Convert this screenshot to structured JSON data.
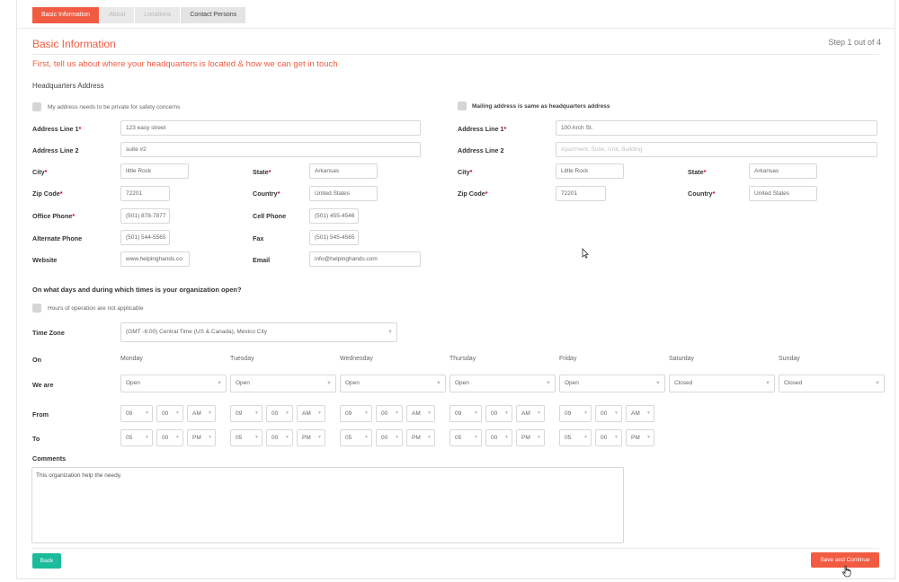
{
  "tabs": [
    {
      "label": "Basic Information"
    },
    {
      "label": "About"
    },
    {
      "label": "Locations"
    },
    {
      "label": "Contact Persons"
    }
  ],
  "section_title": "Basic Information",
  "step_text": "Step 1 out of 4",
  "intro_text": "First, tell us about where your headquarters is located & how we can get in touch",
  "hq_heading": "Headquarters Address",
  "private_label": "My address needs to be private for safety concerns",
  "mailing_same_label": "Mailing address is same as headquarters address",
  "req_mark": "*",
  "hq": {
    "address1_label": "Address Line 1",
    "address1_value": "123 easy street",
    "address2_label": "Address Line 2",
    "address2_value": "suite #2",
    "city_label": "City",
    "city_value": "little Rock",
    "state_label": "State",
    "state_value": "Arkansas",
    "zip_label": "Zip Code",
    "zip_value": "72201",
    "country_label": "Country",
    "country_value": "United States",
    "office_phone_label": "Office Phone",
    "office_phone_value": "(501) 878-7877",
    "cell_phone_label": "Cell Phone",
    "cell_phone_value": "(501) 455-4546",
    "alt_phone_label": "Alternate Phone",
    "alt_phone_value": "(501) 544-5565",
    "fax_label": "Fax",
    "fax_value": "(501) 545-4565",
    "website_label": "Website",
    "website_value": "www.helpinghands.co",
    "email_label": "Email",
    "email_value": "info@helpinghands.com"
  },
  "mailing": {
    "address1_label": "Address Line 1",
    "address1_value": "100 Arch St.",
    "address2_label": "Address Line 2",
    "address2_placeholder": "Apartment, Suite, Unit, Building",
    "city_label": "City",
    "city_value": "Little Rock",
    "state_label": "State",
    "state_value": "Arkansas",
    "zip_label": "Zip Code",
    "zip_value": "72201",
    "country_label": "Country",
    "country_value": "United States"
  },
  "hours_question": "On what days and during which times is your organization open?",
  "hours_na_label": "Hours of operation are not applicable",
  "timezone_label": "Time Zone",
  "timezone_value": "(GMT -6:00) Central Time (US & Canada), Mexico City",
  "on_label": "On",
  "we_are_label": "We are",
  "from_label": "From",
  "to_label": "To",
  "days": [
    {
      "name": "Monday",
      "status": "Open",
      "from_h": "09",
      "from_m": "00",
      "from_ap": "AM",
      "to_h": "05",
      "to_m": "00",
      "to_ap": "PM"
    },
    {
      "name": "Tuesday",
      "status": "Open",
      "from_h": "09",
      "from_m": "00",
      "from_ap": "AM",
      "to_h": "05",
      "to_m": "00",
      "to_ap": "PM"
    },
    {
      "name": "Wednesday",
      "status": "Open",
      "from_h": "09",
      "from_m": "00",
      "from_ap": "AM",
      "to_h": "05",
      "to_m": "00",
      "to_ap": "PM"
    },
    {
      "name": "Thursday",
      "status": "Open",
      "from_h": "09",
      "from_m": "00",
      "from_ap": "AM",
      "to_h": "05",
      "to_m": "00",
      "to_ap": "PM"
    },
    {
      "name": "Friday",
      "status": "Open",
      "from_h": "09",
      "from_m": "00",
      "from_ap": "AM",
      "to_h": "05",
      "to_m": "00",
      "to_ap": "PM"
    },
    {
      "name": "Saturday",
      "status": "Closed"
    },
    {
      "name": "Sunday",
      "status": "Closed"
    }
  ],
  "comments_label": "Comments",
  "comments_value": "This organization help the needy.",
  "back_label": "Back",
  "save_label": "Save and Continue",
  "colors": {
    "accent": "#f15b42",
    "back_button": "#1bbc9b"
  },
  "icons": {
    "caret": "chevron-down-icon",
    "pointer": "mouse-pointer-icon",
    "hand": "hand-cursor-icon"
  }
}
